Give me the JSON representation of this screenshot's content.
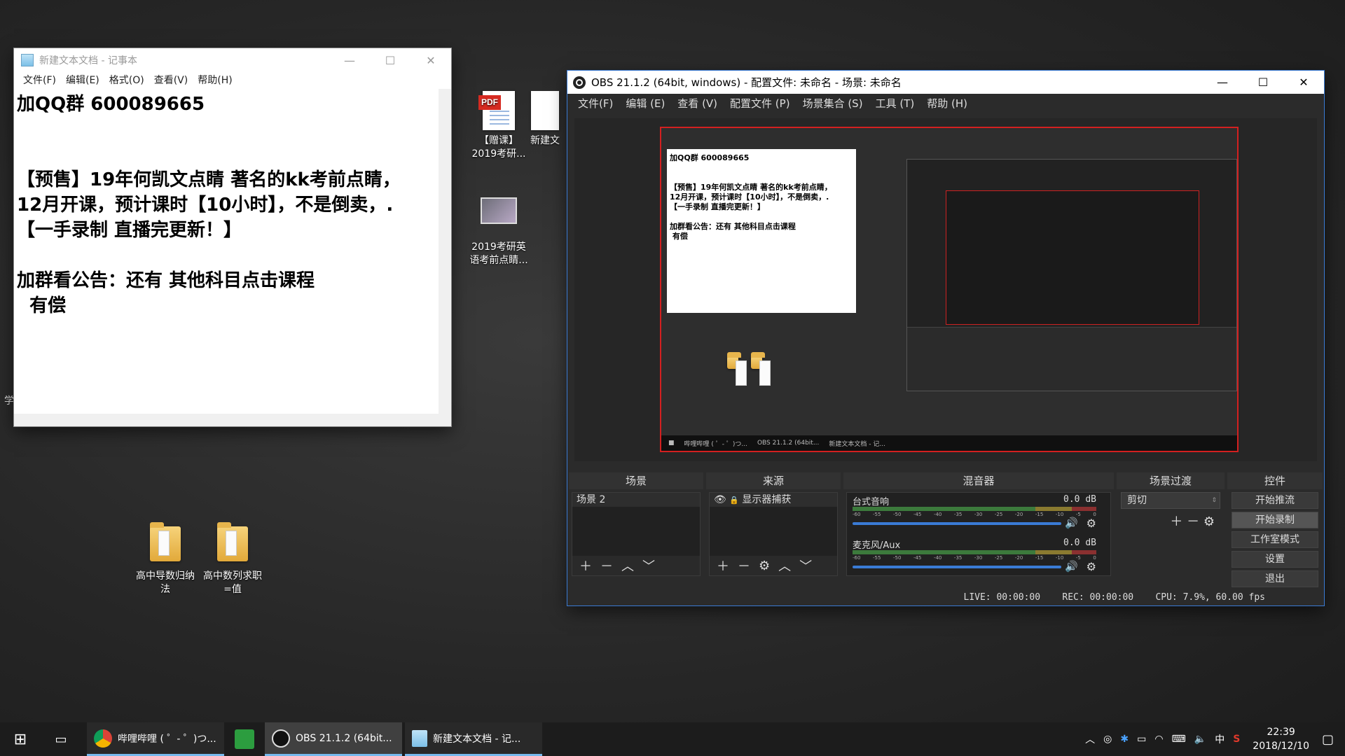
{
  "desktop": {
    "icons": [
      {
        "label": "【赠课】\n2019考研..."
      },
      {
        "label": "新建文"
      },
      {
        "label": "2019考研英\n语考前点睛..."
      },
      {
        "label": "高中导数归纳\n法"
      },
      {
        "label": "高中数列求职\n=值"
      }
    ],
    "edge_text": "学"
  },
  "notepad": {
    "title": "新建文本文档 - 记事本",
    "menu": [
      "文件(F)",
      "编辑(E)",
      "格式(O)",
      "查看(V)",
      "帮助(H)"
    ],
    "content": "加QQ群 600089665\n\n\n【预售】19年何凯文点睛 著名的kk考前点睛，\n12月开课，预计课时【10小时】，不是倒卖，.\n【一手录制 直播完更新！】\n\n加群看公告：还有 其他科目点击课程\n  有偿"
  },
  "obs": {
    "title": "OBS 21.1.2 (64bit, windows) - 配置文件: 未命名 - 场景: 未命名",
    "menu": [
      "文件(F)",
      "编辑 (E)",
      "查看 (V)",
      "配置文件 (P)",
      "场景集合 (S)",
      "工具 (T)",
      "帮助 (H)"
    ],
    "preview": {
      "mini_notepad_text": "加QQ群 600089665\n\n\n【预售】19年何凯文点睛 著名的kk考前点睛，\n12月开课，预计课时【10小时】，不是倒卖，.\n【一手录制 直播完更新！】\n\n加群看公告：还有 其他科目点击课程\n 有偿",
      "mini_taskbar": [
        "哔哩哔哩 ( ゜- ゜)つ...",
        "OBS 21.1.2 (64bit...",
        "新建文本文档 - 记..."
      ]
    },
    "docks": {
      "scenes": {
        "header": "场景",
        "items": [
          "场景 2"
        ]
      },
      "sources": {
        "header": "来源",
        "items": [
          "显示器捕获"
        ]
      },
      "mixer": {
        "header": "混音器",
        "channels": [
          {
            "name": "台式音响",
            "level": "0.0 dB"
          },
          {
            "name": "麦克风/Aux",
            "level": "0.0 dB"
          }
        ],
        "ticks": [
          "-60",
          "-55",
          "-50",
          "-45",
          "-40",
          "-35",
          "-30",
          "-25",
          "-20",
          "-15",
          "-10",
          "-5",
          "0"
        ]
      },
      "transitions": {
        "header": "场景过渡",
        "selected": "剪切"
      },
      "controls": {
        "header": "控件",
        "buttons": [
          "开始推流",
          "开始录制",
          "工作室模式",
          "设置",
          "退出"
        ]
      }
    },
    "status": {
      "live": "LIVE: 00:00:00",
      "rec": "REC: 00:00:00",
      "cpu": "CPU: 7.9%, 60.00 fps"
    }
  },
  "taskbar": {
    "tasks": [
      "哔哩哔哩 ( ゜- ゜)つ...",
      "OBS 21.1.2 (64bit...",
      "新建文本文档 - 记..."
    ],
    "ime": "中",
    "time": "22:39",
    "date": "2018/12/10"
  },
  "colors": {
    "accent": "#3a7bd5",
    "preview_border": "#d32020",
    "taskbar_indicator": "#76b9ed"
  }
}
